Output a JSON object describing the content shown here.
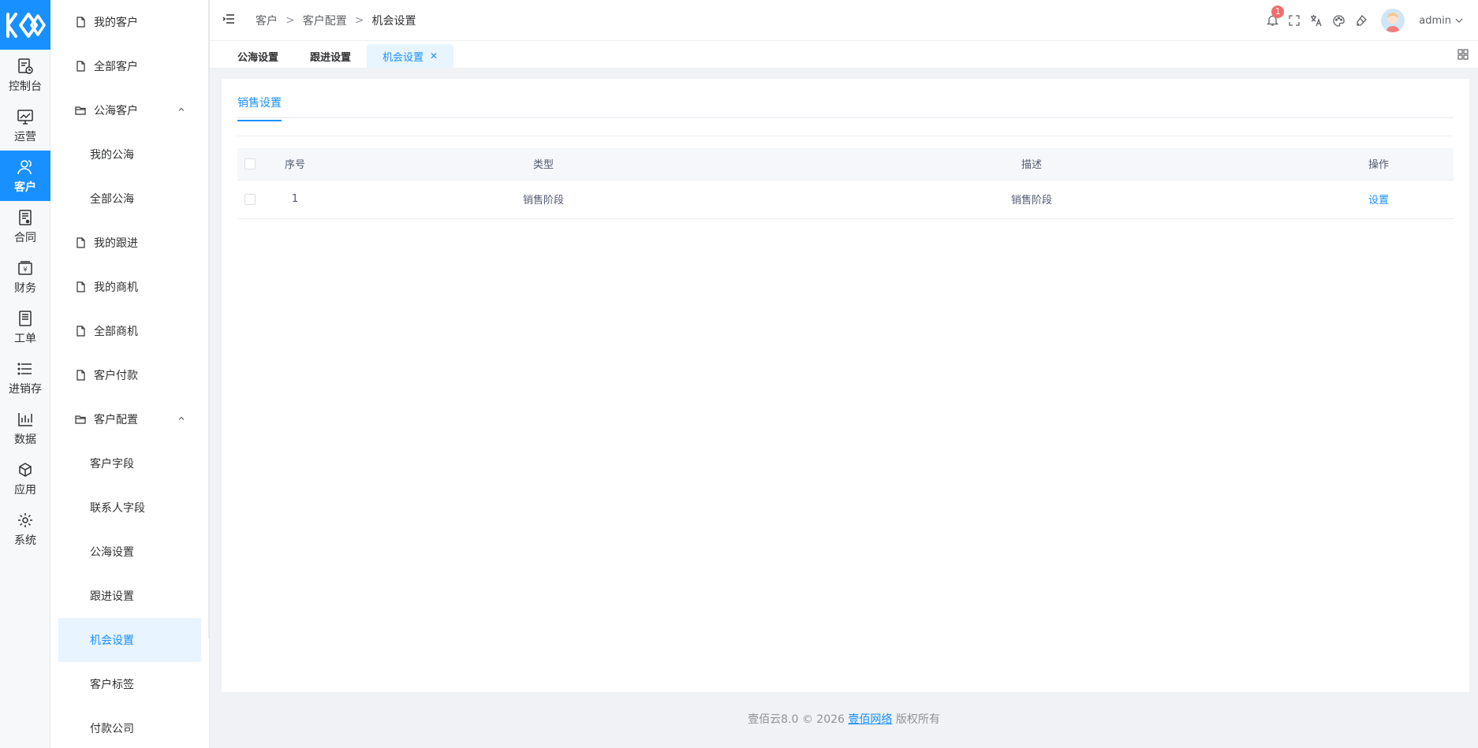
{
  "rail": {
    "items": [
      {
        "label": "控制台",
        "icon": "dashboard-icon"
      },
      {
        "label": "运营",
        "icon": "operations-chart-icon"
      },
      {
        "label": "客户",
        "icon": "customer-icon",
        "active": true
      },
      {
        "label": "合同",
        "icon": "contract-icon"
      },
      {
        "label": "财务",
        "icon": "finance-icon"
      },
      {
        "label": "工单",
        "icon": "work-order-icon"
      },
      {
        "label": "进销存",
        "icon": "inventory-list-icon"
      },
      {
        "label": "数据",
        "icon": "data-chart-icon"
      },
      {
        "label": "应用",
        "icon": "app-cube-icon"
      },
      {
        "label": "系统",
        "icon": "system-gear-icon"
      }
    ]
  },
  "menu": {
    "my_customers": "我的客户",
    "all_customers": "全部客户",
    "public_sea": "公海客户",
    "my_public_sea": "我的公海",
    "all_public_sea": "全部公海",
    "my_followup": "我的跟进",
    "my_opportunities": "我的商机",
    "all_opportunities": "全部商机",
    "customer_payment": "客户付款",
    "customer_config": "客户配置",
    "customer_fields": "客户字段",
    "contact_fields": "联系人字段",
    "public_sea_settings": "公海设置",
    "followup_settings": "跟进设置",
    "opportunity_settings": "机会设置",
    "customer_tags": "客户标签",
    "payment_company": "付款公司"
  },
  "breadcrumb": {
    "level1": "客户",
    "level2": "客户配置",
    "level3": "机会设置",
    "sep": ">"
  },
  "header": {
    "notification_count": "1",
    "user_name": "admin"
  },
  "tabs": [
    {
      "label": "公海设置"
    },
    {
      "label": "跟进设置"
    },
    {
      "label": "机会设置",
      "active": true
    }
  ],
  "content": {
    "subtab": "销售设置",
    "table": {
      "headers": {
        "index": "序号",
        "type": "类型",
        "desc": "描述",
        "action": "操作"
      },
      "rows": [
        {
          "index": "1",
          "type": "销售阶段",
          "desc": "销售阶段",
          "action": "设置"
        }
      ]
    }
  },
  "footer": {
    "prefix": "壹佰云8.0 © 2026",
    "link": "壹佰网络",
    "suffix": "版权所有"
  },
  "colors": {
    "accent": "#1890ff",
    "badge": "#f56c6c"
  }
}
